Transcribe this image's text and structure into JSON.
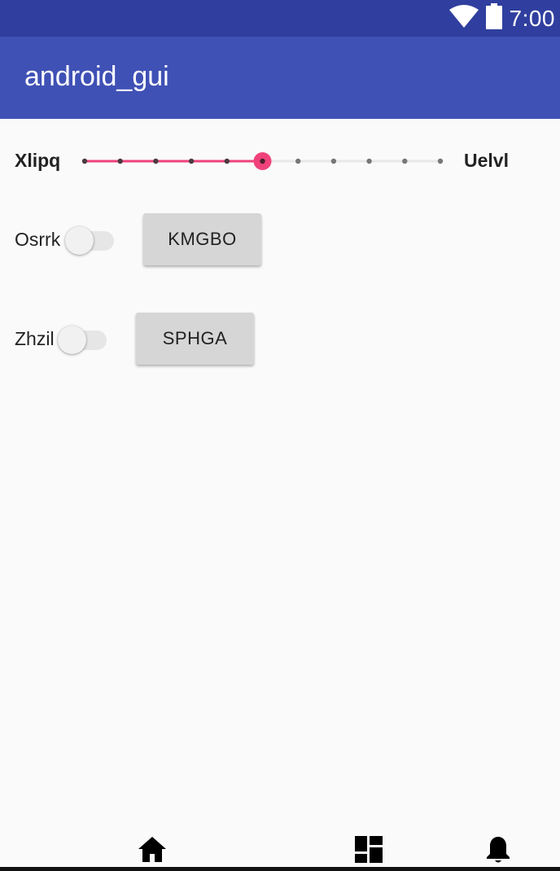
{
  "status_bar": {
    "time": "7:00",
    "icons": [
      "wifi-icon",
      "battery-icon"
    ],
    "color": "#303f9f"
  },
  "app_bar": {
    "title": "android_gui",
    "color": "#3f51b5"
  },
  "slider": {
    "start_label": "Xlipq",
    "end_label": "Uelvl",
    "steps": 10,
    "value": 5,
    "accent": "#f0427a"
  },
  "rows": [
    {
      "switch_label": "Osrrk",
      "switch_on": false,
      "button_label": "KMGBO"
    },
    {
      "switch_label": "Zhzil",
      "switch_on": false,
      "button_label": "SPHGA"
    }
  ],
  "bottom_nav": {
    "icons": [
      "home-icon",
      "dashboard-icon",
      "notifications-icon"
    ]
  }
}
